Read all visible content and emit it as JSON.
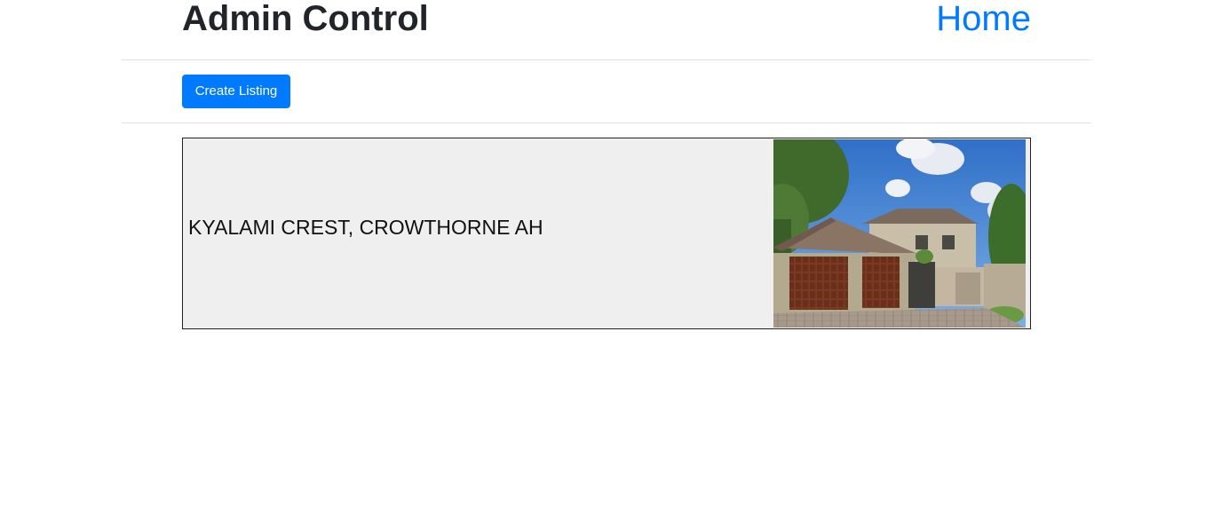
{
  "header": {
    "title": "Admin Control",
    "home_link": "Home"
  },
  "toolbar": {
    "create_label": "Create Listing"
  },
  "colors": {
    "accent": "#007bff",
    "card_background": "#efefef",
    "divider": "#e0e0e0"
  },
  "listings": [
    {
      "name": "KYALAMI CREST, CROWTHORNE AH",
      "photo_icon": "house-photo"
    }
  ]
}
